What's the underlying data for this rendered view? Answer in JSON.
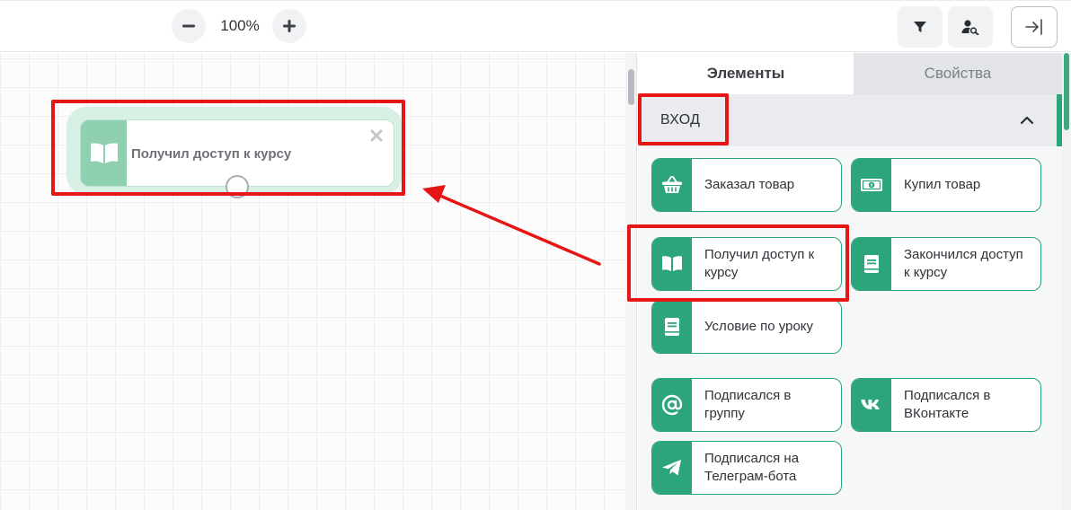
{
  "toolbar": {
    "zoom_level": "100%",
    "icons": {
      "zoom_out": "minus-icon",
      "zoom_in": "plus-icon",
      "filter": "filter-icon",
      "user_search": "user-search-icon",
      "collapse": "collapse-panel-icon"
    }
  },
  "canvas": {
    "node": {
      "label": "Получил доступ к курсу",
      "icon": "open-book-icon"
    }
  },
  "panel": {
    "tabs": [
      {
        "label": "Элементы",
        "active": true
      },
      {
        "label": "Свойства",
        "active": false
      }
    ],
    "section": {
      "title": "ВХОД",
      "expanded": true
    },
    "items": [
      {
        "label": "Заказал товар",
        "icon": "basket-icon"
      },
      {
        "label": "Купил товар",
        "icon": "banknote-icon"
      },
      {
        "label": "Получил доступ к курсу",
        "icon": "open-book-icon"
      },
      {
        "label": "Закончился доступ к курсу",
        "icon": "closed-book-icon"
      },
      {
        "label": "Условие по уроку",
        "icon": "closed-book-icon"
      },
      {
        "label": "Подписался в группу",
        "icon": "at-sign-icon"
      },
      {
        "label": "Подписался в ВКонтакте",
        "icon": "vk-icon"
      },
      {
        "label": "Подписался на Телеграм-бота",
        "icon": "telegram-icon"
      }
    ]
  },
  "colors": {
    "accent": "#2ca57a",
    "node_light": "#8ed0b0",
    "highlight": "#e61616"
  }
}
